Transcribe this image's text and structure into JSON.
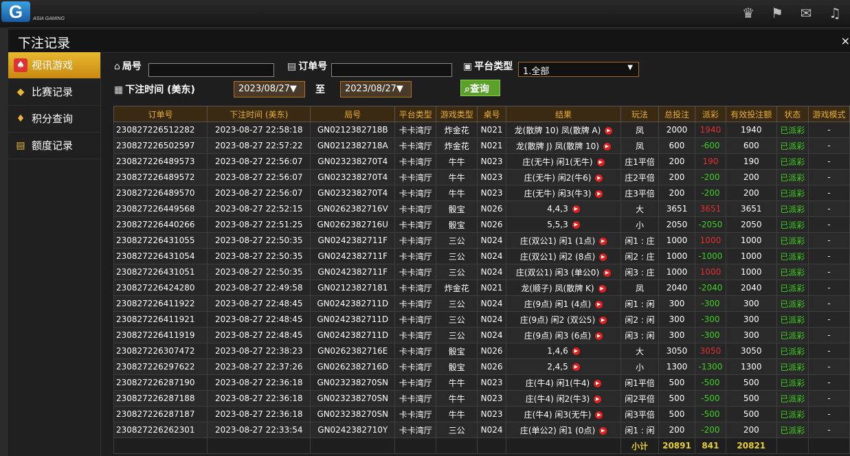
{
  "brand": {
    "logo": "G",
    "subtitle": "ASIA GAMING"
  },
  "top_icons": [
    "vip-icon",
    "flag-icon",
    "chat-icon",
    "music-icon"
  ],
  "modal": {
    "title": "下注记录",
    "close": "×"
  },
  "sidebar": {
    "items": [
      {
        "label": "视讯游戏",
        "icon": "cards-icon",
        "active": true
      },
      {
        "label": "比赛记录",
        "icon": "diamond-tag-icon",
        "active": false
      },
      {
        "label": "积分查询",
        "icon": "gem-icon",
        "active": false
      },
      {
        "label": "额度记录",
        "icon": "document-icon",
        "active": false
      }
    ]
  },
  "filters": {
    "round_label": "局号",
    "round_value": "",
    "order_label": "订单号",
    "order_value": "",
    "platform_label": "平台类型",
    "platform_value": "1.全部",
    "time_label": "下注时间 (美东)",
    "date_from": "2023/08/27▼",
    "to_label": "至",
    "date_to": "2023/08/27▼",
    "query_button": "查询"
  },
  "table": {
    "columns": [
      "订单号",
      "下注时间 (美东)",
      "局号",
      "平台类型",
      "游戏类型",
      "桌号",
      "结果",
      "玩法",
      "总投注",
      "派彩",
      "有效投注额",
      "状态",
      "游戏模式"
    ],
    "rows": [
      [
        "230827226512282",
        "2023-08-27 22:58:18",
        "GN0212382718B",
        "卡卡湾厅",
        "炸金花",
        "N021",
        "龙(散牌 10) 凤(散牌 A)",
        "凤",
        "2000",
        "1940",
        "1940",
        "已派彩",
        "-"
      ],
      [
        "230827226502597",
        "2023-08-27 22:57:22",
        "GN0212382718A",
        "卡卡湾厅",
        "炸金花",
        "N021",
        "龙(散牌 J) 凤(散牌 10)",
        "凤",
        "600",
        "-600",
        "600",
        "已派彩",
        "-"
      ],
      [
        "230827226489573",
        "2023-08-27 22:56:07",
        "GN023238270T4",
        "卡卡湾厅",
        "牛牛",
        "N023",
        "庄(无牛) 闲1(无牛)",
        "庄1平倍",
        "200",
        "190",
        "190",
        "已派彩",
        "-"
      ],
      [
        "230827226489572",
        "2023-08-27 22:56:07",
        "GN023238270T4",
        "卡卡湾厅",
        "牛牛",
        "N023",
        "庄(无牛) 闲2(牛6)",
        "庄2平倍",
        "200",
        "-200",
        "200",
        "已派彩",
        "-"
      ],
      [
        "230827226489570",
        "2023-08-27 22:56:07",
        "GN023238270T4",
        "卡卡湾厅",
        "牛牛",
        "N023",
        "庄(无牛) 闲3(牛3)",
        "庄3平倍",
        "200",
        "-200",
        "200",
        "已派彩",
        "-"
      ],
      [
        "230827226449568",
        "2023-08-27 22:52:15",
        "GN0262382716V",
        "卡卡湾厅",
        "骰宝",
        "N026",
        "4,4,3",
        "大",
        "3651",
        "3651",
        "3651",
        "已派彩",
        "-"
      ],
      [
        "230827226440266",
        "2023-08-27 22:51:25",
        "GN0262382716U",
        "卡卡湾厅",
        "骰宝",
        "N026",
        "5,5,3",
        "小",
        "2050",
        "-2050",
        "2050",
        "已派彩",
        "-"
      ],
      [
        "230827226431055",
        "2023-08-27 22:50:35",
        "GN0242382711F",
        "卡卡湾厅",
        "三公",
        "N024",
        "庄(双公1) 闲1 (1点)",
        "闲1 : 庄",
        "1000",
        "1000",
        "1000",
        "已派彩",
        "-"
      ],
      [
        "230827226431054",
        "2023-08-27 22:50:35",
        "GN0242382711F",
        "卡卡湾厅",
        "三公",
        "N024",
        "庄(双公1) 闲2 (8点)",
        "闲2 : 庄",
        "1000",
        "-1000",
        "1000",
        "已派彩",
        "-"
      ],
      [
        "230827226431051",
        "2023-08-27 22:50:35",
        "GN0242382711F",
        "卡卡湾厅",
        "三公",
        "N024",
        "庄(双公1) 闲3 (单公0)",
        "闲3 : 庄",
        "1000",
        "1000",
        "1000",
        "已派彩",
        "-"
      ],
      [
        "230827226424280",
        "2023-08-27 22:49:58",
        "GN02123827181",
        "卡卡湾厅",
        "炸金花",
        "N021",
        "龙(顺子) 凤(散牌 K)",
        "凤",
        "2040",
        "-2040",
        "2040",
        "已派彩",
        "-"
      ],
      [
        "230827226411922",
        "2023-08-27 22:48:45",
        "GN0242382711D",
        "卡卡湾厅",
        "三公",
        "N024",
        "庄(9点) 闲1 (4点)",
        "闲1 : 闲",
        "300",
        "-300",
        "300",
        "已派彩",
        "-"
      ],
      [
        "230827226411921",
        "2023-08-27 22:48:45",
        "GN0242382711D",
        "卡卡湾厅",
        "三公",
        "N024",
        "庄(9点) 闲2 (双公5)",
        "闲2 : 闲",
        "300",
        "-300",
        "300",
        "已派彩",
        "-"
      ],
      [
        "230827226411919",
        "2023-08-27 22:48:45",
        "GN0242382711D",
        "卡卡湾厅",
        "三公",
        "N024",
        "庄(9点) 闲3 (6点)",
        "闲3 : 闲",
        "300",
        "-300",
        "300",
        "已派彩",
        "-"
      ],
      [
        "230827226307472",
        "2023-08-27 22:38:23",
        "GN0262382716E",
        "卡卡湾厅",
        "骰宝",
        "N026",
        "1,4,6",
        "大",
        "3050",
        "3050",
        "3050",
        "已派彩",
        "-"
      ],
      [
        "230827226297622",
        "2023-08-27 22:37:26",
        "GN0262382716D",
        "卡卡湾厅",
        "骰宝",
        "N026",
        "2,4,5",
        "小",
        "1300",
        "-1300",
        "1300",
        "已派彩",
        "-"
      ],
      [
        "230827226287190",
        "2023-08-27 22:36:18",
        "GN023238270SN",
        "卡卡湾厅",
        "牛牛",
        "N023",
        "庄(牛4) 闲1(牛4)",
        "闲1平倍",
        "500",
        "-500",
        "500",
        "已派彩",
        "-"
      ],
      [
        "230827226287188",
        "2023-08-27 22:36:18",
        "GN023238270SN",
        "卡卡湾厅",
        "牛牛",
        "N023",
        "庄(牛4) 闲2(牛3)",
        "闲2平倍",
        "500",
        "-500",
        "500",
        "已派彩",
        "-"
      ],
      [
        "230827226287187",
        "2023-08-27 22:36:18",
        "GN023238270SN",
        "卡卡湾厅",
        "牛牛",
        "N023",
        "庄(牛4) 闲3(无牛)",
        "闲3平倍",
        "500",
        "-500",
        "500",
        "已派彩",
        "-"
      ],
      [
        "230827226262301",
        "2023-08-27 22:33:54",
        "GN0242382710Y",
        "卡卡湾厅",
        "三公",
        "N024",
        "庄(单公2) 闲1 (0点)",
        "闲1 : 闲",
        "200",
        "-200",
        "200",
        "已派彩",
        "-"
      ]
    ],
    "total": {
      "label": "小计",
      "bet": "20891",
      "payout": "841",
      "valid": "20821"
    }
  }
}
